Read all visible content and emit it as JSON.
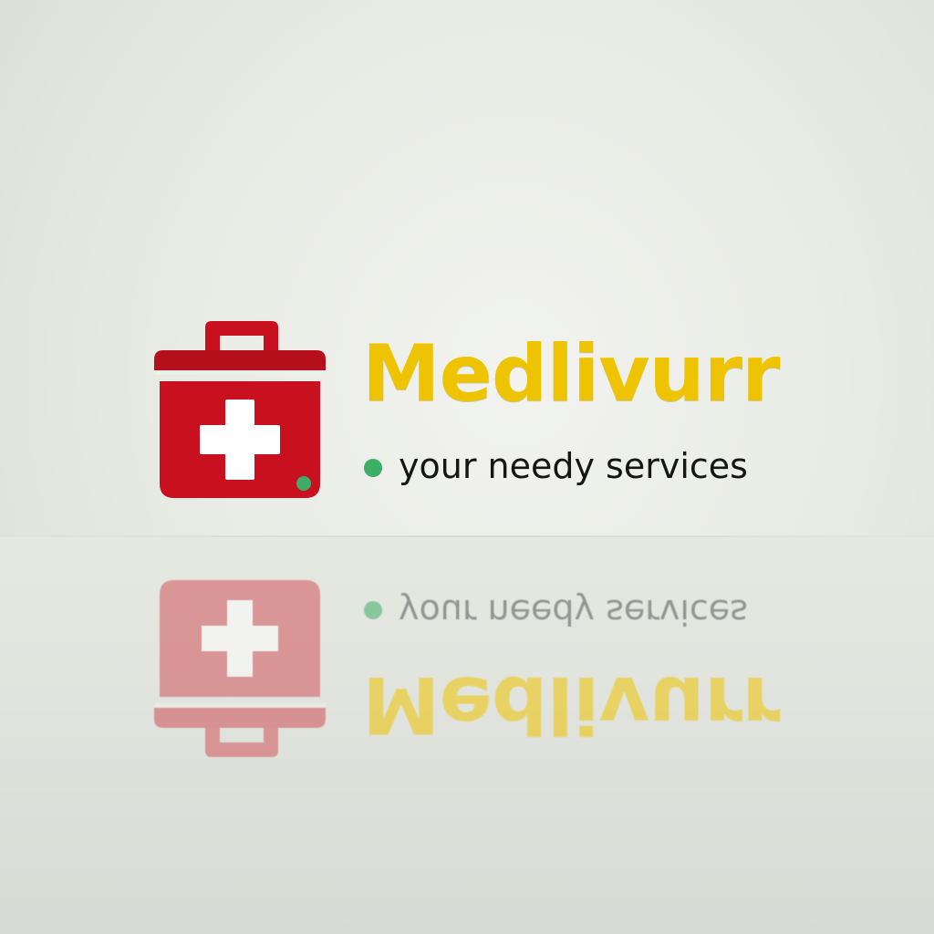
{
  "brand": {
    "name": "Medlivurr",
    "tagline": "your needy services"
  },
  "colors": {
    "kit_red": "#c8101e",
    "brand_yellow": "#eec400",
    "dot_green": "#3eae67",
    "text_dark": "#151515"
  },
  "icons": {
    "logo_mark": "first-aid-kit-icon",
    "tagline_bullet": "green-dot"
  }
}
